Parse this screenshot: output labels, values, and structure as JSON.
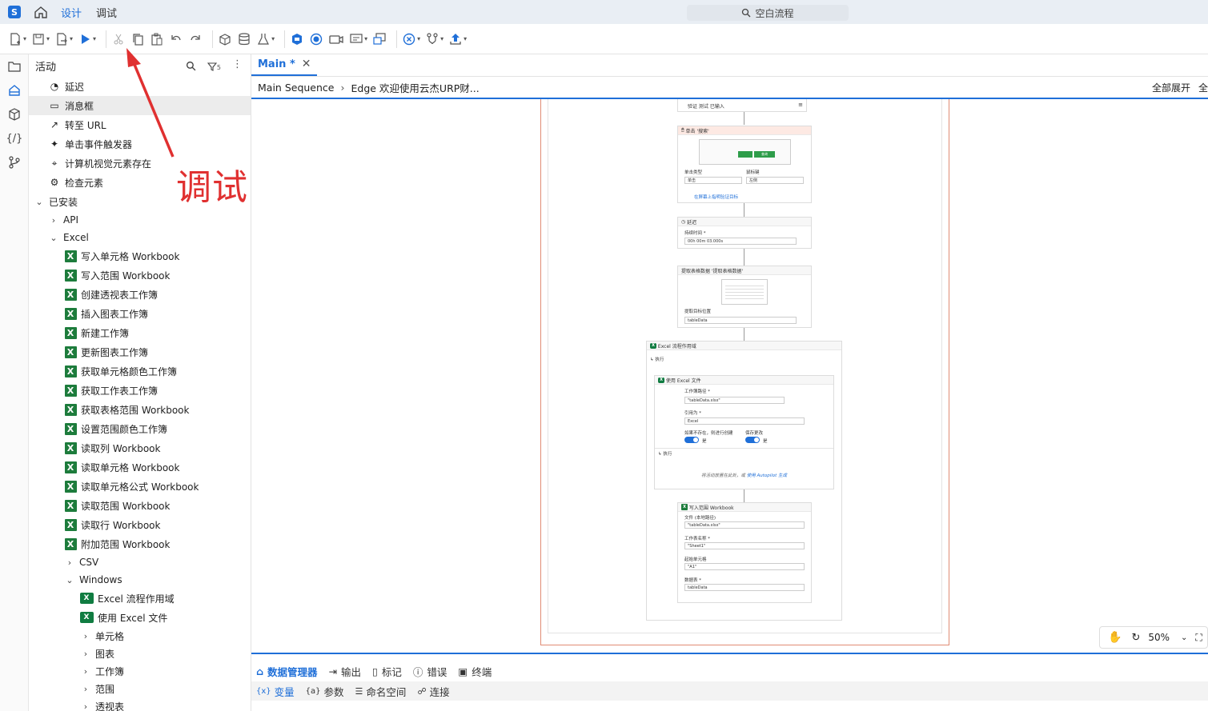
{
  "titlebar": {
    "tabs": [
      "设计",
      "调试"
    ],
    "search": "空白流程"
  },
  "panel": {
    "title": "活动",
    "filter_count": "5",
    "top_items": [
      "延迟",
      "消息框",
      "转至 URL",
      "单击事件触发器",
      "计算机视觉元素存在",
      "检查元素"
    ],
    "installed": "已安装",
    "api": "API",
    "excel": "Excel",
    "excel_items": [
      "写入单元格 Workbook",
      "写入范围 Workbook",
      "创建透视表工作簿",
      "插入图表工作簿",
      "新建工作簿",
      "更新图表工作簿",
      "获取单元格颜色工作簿",
      "获取工作表工作簿",
      "获取表格范围 Workbook",
      "设置范围颜色工作簿",
      "读取列 Workbook",
      "读取单元格 Workbook",
      "读取单元格公式 Workbook",
      "读取范围 Workbook",
      "读取行 Workbook",
      "附加范围 Workbook"
    ],
    "csv": "CSV",
    "windows": "Windows",
    "windows_items": [
      "Excel 流程作用域",
      "使用 Excel 文件"
    ],
    "windows_sub": [
      "单元格",
      "图表",
      "工作簿",
      "范围",
      "透视表"
    ]
  },
  "editor": {
    "tab": "Main *",
    "crumbs": [
      "Main Sequence",
      "Edge 欢迎使用云杰URP财..."
    ],
    "expand_all": "全部展开",
    "cut": "全"
  },
  "workflow": {
    "verify": "验证 测试 已输入",
    "click": {
      "title": "单击 '搜索'",
      "click_type_label": "单击类型",
      "click_type": "单击",
      "mouse_label": "鼠标键",
      "mouse": "左侧",
      "indicate": "在屏幕上指明验证目标",
      "thumb_btn": "查询"
    },
    "delay": {
      "title": "延迟",
      "dur_label": "持续时间 *",
      "dur": "00h 00m 03.000s"
    },
    "extract": {
      "title": "提取表格数据 '提取表格数据'",
      "pos_label": "提取目标位置",
      "pos": "tableData"
    },
    "scope": {
      "title": "Excel 流程作用域",
      "do": "执行"
    },
    "useexcel": {
      "title": "使用 Excel 文件",
      "path_label": "工作簿路径 *",
      "path": "\"tableData.xlsx\"",
      "ref_label": "引用为 *",
      "ref": "Excel",
      "create_label": "如果不存在，则进行创建",
      "create_val": "是",
      "save_label": "保存更改",
      "save_val": "是",
      "do": "执行",
      "drop": "将活动放置在此处，或",
      "autopilot": "使用 Autopilot 生成"
    },
    "write": {
      "title": "写入范围 Workbook",
      "file_label": "文件 (本地路径)",
      "file": "\"tableData.xlsx\"",
      "sheet_label": "工作表名称 *",
      "sheet": "\"Sheet1\"",
      "start_label": "起始单元格",
      "start": "\"A1\"",
      "data_label": "数据表 *",
      "data": "tableData"
    }
  },
  "zoom": "50%",
  "bottom": {
    "tabs": [
      "数据管理器",
      "输出",
      "标记",
      "错误",
      "终端"
    ],
    "subtabs": [
      "变量",
      "参数",
      "命名空间",
      "连接"
    ]
  },
  "annotation": "调试"
}
